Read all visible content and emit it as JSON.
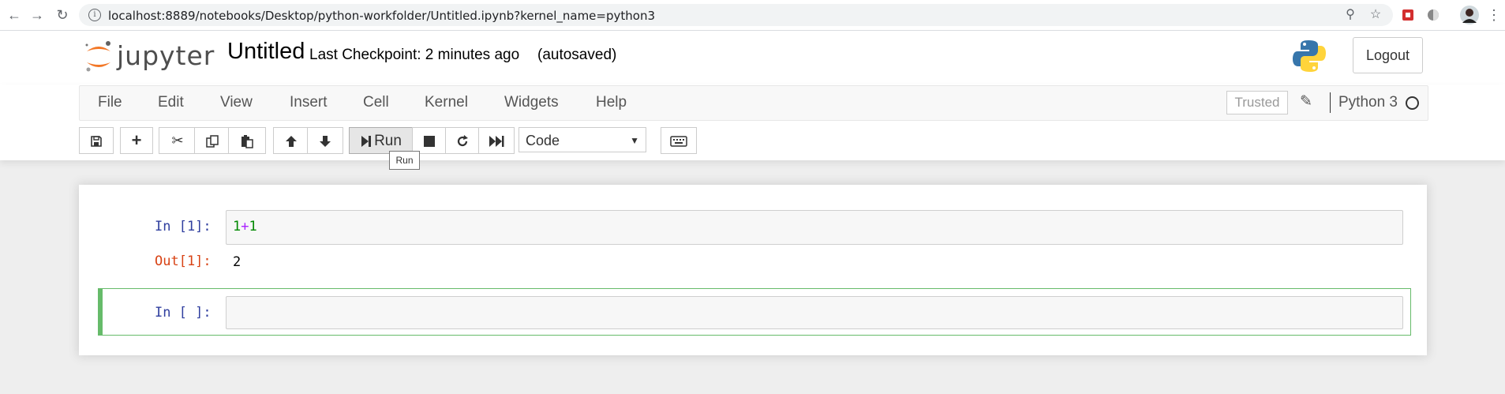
{
  "browser": {
    "url": "localhost:8889/notebooks/Desktop/python-workfolder/Untitled.ipynb?kernel_name=python3"
  },
  "header": {
    "logo_text": "jupyter",
    "notebook_name": "Untitled",
    "checkpoint": "Last Checkpoint: 2 minutes ago",
    "autosave_status": "(autosaved)",
    "logout_label": "Logout"
  },
  "menubar": {
    "items": [
      "File",
      "Edit",
      "View",
      "Insert",
      "Cell",
      "Kernel",
      "Widgets",
      "Help"
    ],
    "trusted_label": "Trusted",
    "kernel_name": "Python 3"
  },
  "toolbar": {
    "run_label": "Run",
    "cell_type": "Code",
    "tooltip": "Run"
  },
  "cells": [
    {
      "prompt": "In [1]:",
      "code_a": "1",
      "code_op": "+",
      "code_b": "1",
      "output_prompt": "Out[1]:",
      "output": "2"
    },
    {
      "prompt": "In [ ]:",
      "code": ""
    }
  ],
  "colors": {
    "prompt_in": "#303f9f",
    "prompt_out": "#d84315",
    "selected_cell_border": "#66bb6a",
    "jupyter_orange": "#f37726"
  }
}
